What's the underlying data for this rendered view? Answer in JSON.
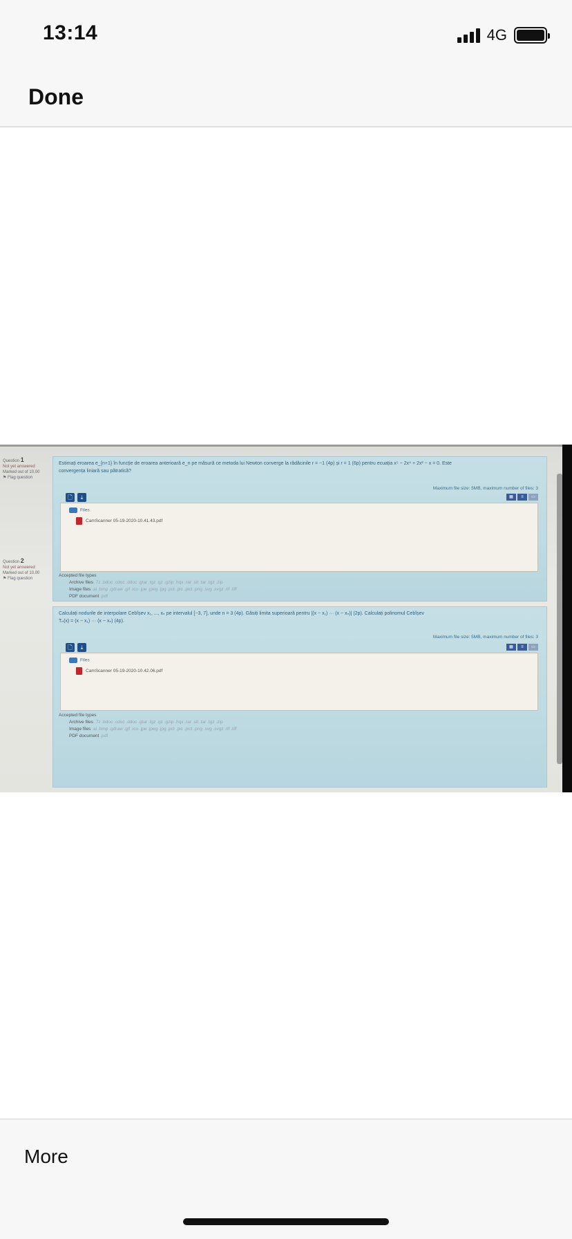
{
  "status_bar": {
    "time": "13:14",
    "network": "4G"
  },
  "header": {
    "done_label": "Done"
  },
  "footer": {
    "more_label": "More"
  },
  "screen": {
    "questions": [
      {
        "label": "Question",
        "number": "1",
        "state": "Not yet answered",
        "marked": "Marked out of 10.00",
        "flag": "Flag question",
        "text_line1": "Estimați eroarea e_{n+1} în funcție de eroarea anterioară e_n pe măsură ce metoda lui Newton converge la rădăcinile r = −1 (4p) și r = 1 (6p) pentru ecuația x⁵ − 2x⁴ + 2x² − x = 0. Este",
        "text_line2": "convergența liniară sau pătratică?",
        "max_size": "Maximum file size: 5MB, maximum number of files: 3",
        "files_label": "Files",
        "file_name": "CamScanner 05-19-2020-10.41.43.pdf",
        "accepted_title": "Accepted file types",
        "accepted": [
          {
            "type": "Archive files",
            "ext": ".7z .bdoc .cdoc .ddoc .gtar .tgz .gz .gzip .hqx .rar .sit .tar .tgz .zip"
          },
          {
            "type": "Image files",
            "ext": ".ai .bmp .gdraw .gif .ico .jpe .jpeg .jpg .pct .pic .pict .png .svg .svgz .tif .tiff"
          },
          {
            "type": "PDF document",
            "ext": ".pdf"
          }
        ]
      },
      {
        "label": "Question",
        "number": "2",
        "state": "Not yet answered",
        "marked": "Marked out of 10.00",
        "flag": "Flag question",
        "text_line1": "Calculați nodurile de interpolare Cebîșev x₁, ..., xₙ pe intervalul [−3, 7], unde n = 3 (4p). Găsiți limita superioară pentru |(x − x₁) ··· (x − xₙ)| (2p). Calculați polinomul Cebîșev",
        "text_line2": "Tₙ(x) = (x − x₁) ··· (x − xₙ) (4p).",
        "max_size": "Maximum file size: 5MB, maximum number of files: 3",
        "files_label": "Files",
        "file_name": "CamScanner 05-19-2020-10.42.06.pdf",
        "accepted_title": "Accepted file types",
        "accepted": [
          {
            "type": "Archive files",
            "ext": ".7z .bdoc .cdoc .ddoc .gtar .tgz .gz .gzip .hqx .rar .sit .tar .tgz .zip"
          },
          {
            "type": "Image files",
            "ext": ".ai .bmp .gdraw .gif .ico .jpe .jpeg .jpg .pct .pic .pict .png .svg .svgz .tif .tiff"
          },
          {
            "type": "PDF document",
            "ext": ".pdf"
          }
        ]
      }
    ]
  }
}
